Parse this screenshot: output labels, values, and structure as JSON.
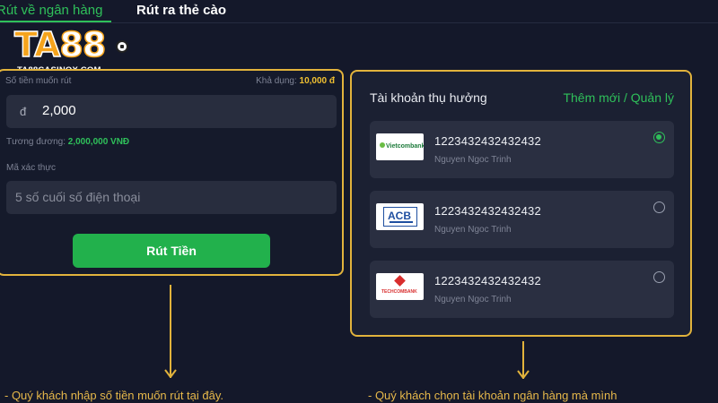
{
  "tabs": [
    {
      "label": "Rút về ngân hàng",
      "active": true
    },
    {
      "label": "Rút ra thẻ cào",
      "active": false
    }
  ],
  "logo": {
    "main_left": "TA",
    "main_right": "88",
    "subtitle": "TA88CASINOX.COM"
  },
  "withdraw_form": {
    "amount_label": "Số tiền muốn rút",
    "available_label": "Khả dụng:",
    "available_value": "10,000 đ",
    "currency_symbol": "đ",
    "amount_value": "2,000",
    "equivalent_label": "Tương đương:",
    "equivalent_value": "2,000,000 VNĐ",
    "code_label": "Mã xác thực",
    "code_placeholder": "5 số cuối số điện thoại",
    "submit_label": "Rút Tiền"
  },
  "beneficiary": {
    "title": "Tài khoản thụ hưởng",
    "manage_link": "Thêm mới / Quản lý",
    "accounts": [
      {
        "bank": "Vietcombank",
        "number": "1223432432432432",
        "holder": "Nguyen Ngoc Trinh",
        "selected": true
      },
      {
        "bank": "ACB",
        "number": "1223432432432432",
        "holder": "Nguyen Ngoc Trinh",
        "selected": false
      },
      {
        "bank": "TECHCOMBANK",
        "number": "1223432432432432",
        "holder": "Nguyen Ngoc Trinh",
        "selected": false
      }
    ]
  },
  "notes": {
    "left": "- Quý khách nhập số tiền muốn rút tại đây.",
    "right": "- Quý khách chọn tài khoản ngân hàng mà mình"
  },
  "colors": {
    "accent_green": "#2fc05a",
    "frame_gold": "#e2b33c",
    "background": "#14182a"
  }
}
